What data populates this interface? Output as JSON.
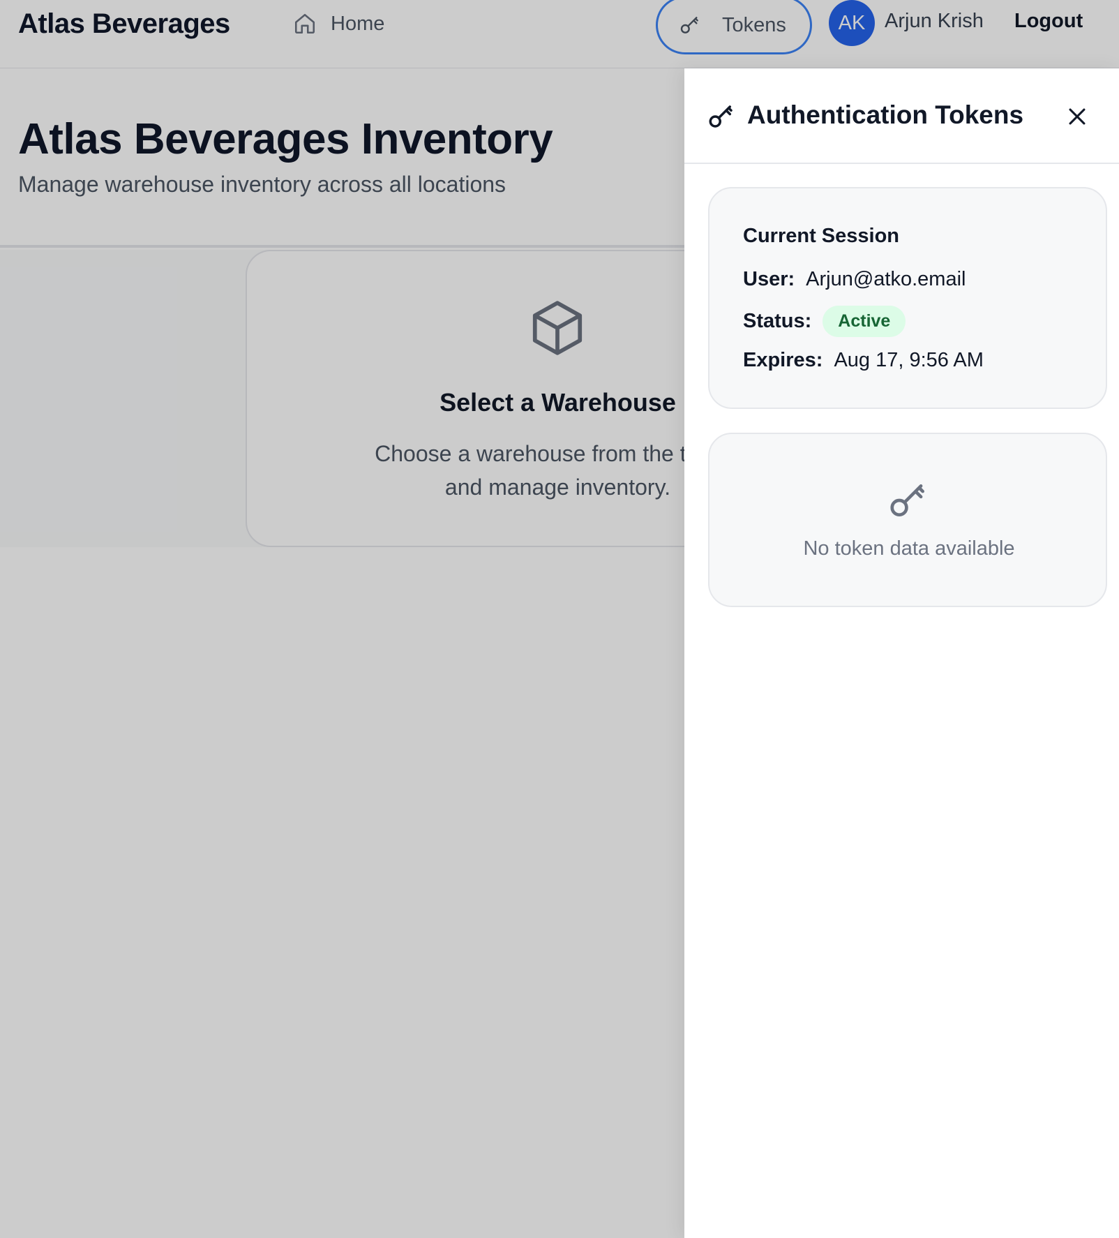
{
  "header": {
    "brand": "Atlas Beverages",
    "nav_home": "Home",
    "tokens_button": "Tokens",
    "avatar_initials": "AK",
    "user_name": "Arjun Krish",
    "logout": "Logout"
  },
  "main": {
    "title": "Atlas Beverages Inventory",
    "subtitle": "Manage warehouse inventory across all locations",
    "empty_state": {
      "title": "Select a Warehouse",
      "description_line1": "Choose a warehouse from the tabs a",
      "description_line2": "and manage inventory."
    }
  },
  "drawer": {
    "title": "Authentication Tokens",
    "session": {
      "heading": "Current Session",
      "user_label": "User:",
      "user_value": "Arjun@atko.email",
      "status_label": "Status:",
      "status_value": "Active",
      "expires_label": "Expires:",
      "expires_value": "Aug 17, 9:56 AM"
    },
    "no_tokens_text": "No token data available"
  },
  "colors": {
    "accent": "#3b82f6",
    "avatar": "#2563eb",
    "status_active_bg": "#dcfce7",
    "status_active_text": "#166534"
  },
  "icons": [
    "home-icon",
    "key-icon",
    "box-icon",
    "close-icon"
  ]
}
